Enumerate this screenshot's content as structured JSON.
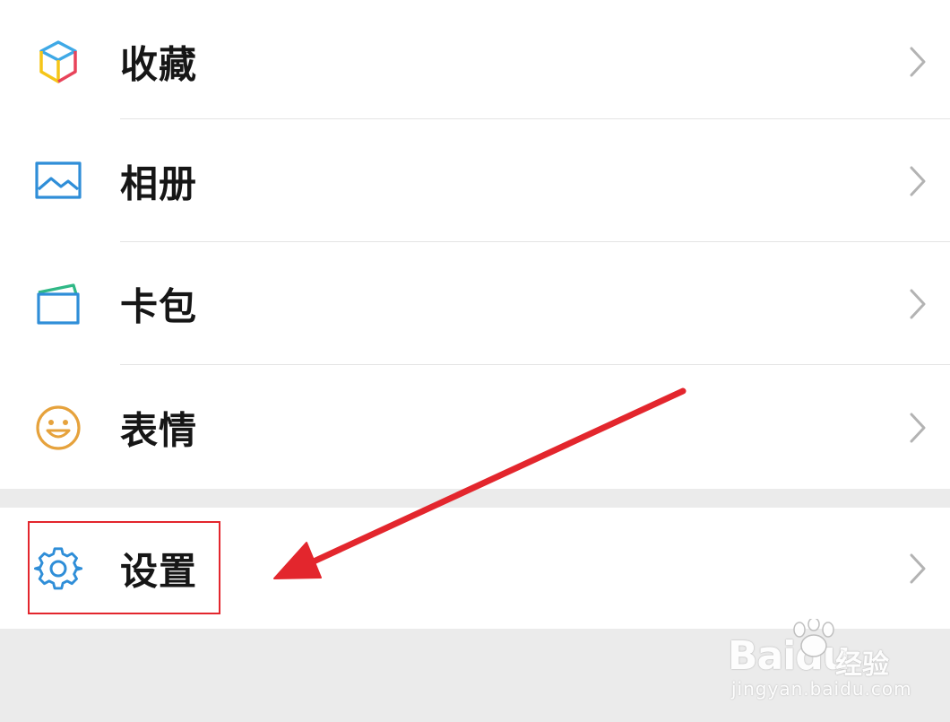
{
  "menu": {
    "items": [
      {
        "label": "收藏",
        "icon": "cube-icon"
      },
      {
        "label": "相册",
        "icon": "picture-icon"
      },
      {
        "label": "卡包",
        "icon": "card-wallet-icon"
      },
      {
        "label": "表情",
        "icon": "smiley-icon"
      }
    ],
    "settings": {
      "label": "设置",
      "icon": "gear-icon"
    }
  },
  "watermark": {
    "brand": "Baidu",
    "sub": "经验",
    "url": "jingyan.baidu.com"
  },
  "colors": {
    "annotation": "#e3262d",
    "icon_blue": "#2f8ed8",
    "icon_orange": "#e6a23c",
    "background": "#ebebeb"
  }
}
